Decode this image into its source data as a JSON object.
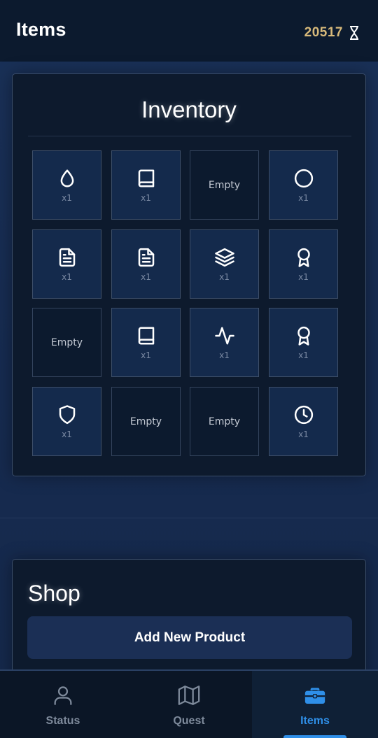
{
  "header": {
    "title": "Items",
    "currency_value": "20517",
    "currency_icon": "hourglass-icon"
  },
  "inventory": {
    "title": "Inventory",
    "slots": [
      {
        "icon": "droplet-icon",
        "qty": "x1",
        "empty": false
      },
      {
        "icon": "book-icon",
        "qty": "x1",
        "empty": false
      },
      {
        "label": "Empty",
        "empty": true
      },
      {
        "icon": "circle-icon",
        "qty": "x1",
        "empty": false
      },
      {
        "icon": "document-icon",
        "qty": "x1",
        "empty": false
      },
      {
        "icon": "document-icon",
        "qty": "x1",
        "empty": false
      },
      {
        "icon": "layers-icon",
        "qty": "x1",
        "empty": false
      },
      {
        "icon": "award-icon",
        "qty": "x1",
        "empty": false
      },
      {
        "label": "Empty",
        "empty": true
      },
      {
        "icon": "book-icon",
        "qty": "x1",
        "empty": false
      },
      {
        "icon": "activity-icon",
        "qty": "x1",
        "empty": false
      },
      {
        "icon": "award-icon",
        "qty": "x1",
        "empty": false
      },
      {
        "icon": "shield-icon",
        "qty": "x1",
        "empty": false
      },
      {
        "label": "Empty",
        "empty": true
      },
      {
        "label": "Empty",
        "empty": true
      },
      {
        "icon": "clock-icon",
        "qty": "x1",
        "empty": false
      }
    ]
  },
  "shop": {
    "title": "Shop",
    "add_button_label": "Add New Product"
  },
  "nav": {
    "tabs": [
      {
        "label": "Status",
        "icon": "user-icon",
        "active": false
      },
      {
        "label": "Quest",
        "icon": "map-icon",
        "active": false
      },
      {
        "label": "Items",
        "icon": "briefcase-icon",
        "active": true
      }
    ]
  },
  "colors": {
    "accent": "#2f8fe8",
    "currency": "#d7b97a",
    "header_bg": "#0c1a2e",
    "panel_bg": "#0d1a2d",
    "slot_bg": "#142a4c"
  }
}
